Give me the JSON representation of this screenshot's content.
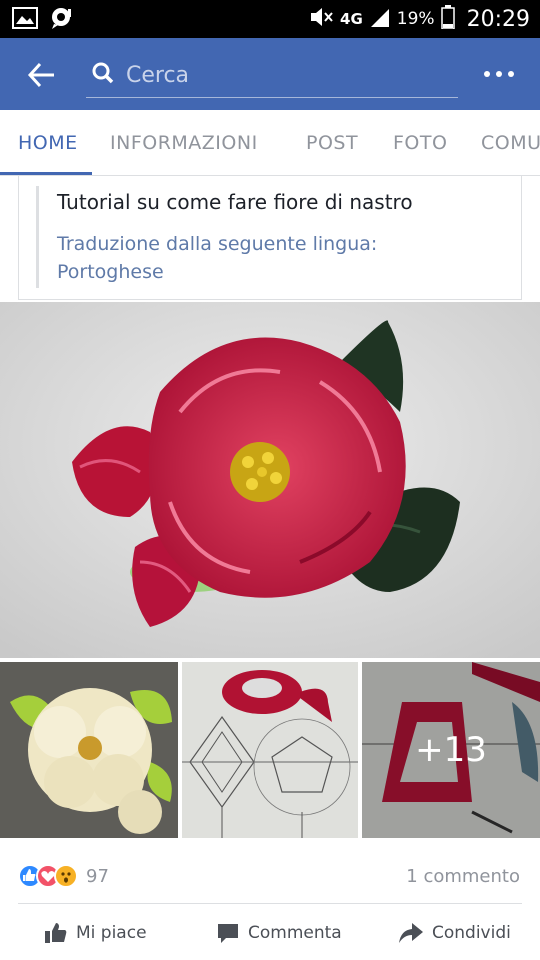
{
  "status_bar": {
    "network": "4G",
    "battery": "19%",
    "time": "20:29"
  },
  "app_bar": {
    "search_placeholder": "Cerca"
  },
  "tabs": [
    {
      "label": "HOME",
      "active": true
    },
    {
      "label": "INFORMAZIONI",
      "active": false
    },
    {
      "label": "POST",
      "active": false
    },
    {
      "label": "FOTO",
      "active": false
    },
    {
      "label": "COMUNITÀ",
      "active": false
    }
  ],
  "post": {
    "text": "Tutorial su come fare fiore di nastro",
    "translation_line1": "Traduzione dalla seguente lingua:",
    "translation_line2": "Portoghese",
    "more_photos": "+13",
    "reaction_count": "97",
    "comments": "1 commento"
  },
  "actions": {
    "like": "Mi piace",
    "comment": "Commenta",
    "share": "Condividi"
  },
  "colors": {
    "brand": "#4267b2",
    "like_blue": "#2e89ff",
    "love_red": "#f25268",
    "wow_yellow": "#f7b125"
  }
}
